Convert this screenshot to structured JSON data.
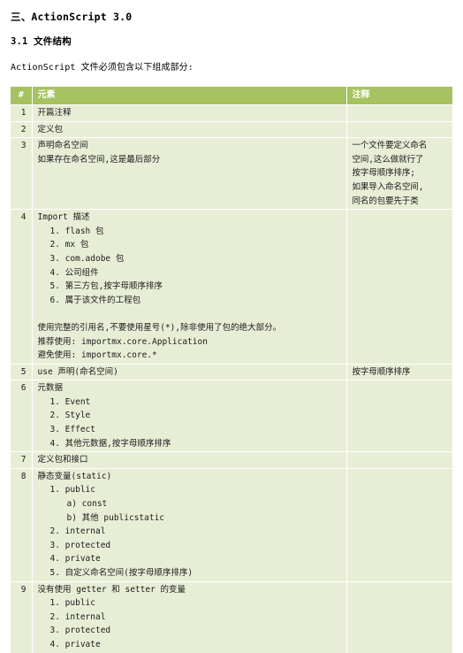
{
  "document": {
    "section_heading": "三、ActionScript 3.0",
    "sub_heading": "3.1 文件结构",
    "lead_paragraph": "ActionScript 文件必须包含以下组成部分:"
  },
  "table": {
    "headers": {
      "num": "#",
      "element": "元素",
      "note": "注释"
    },
    "rows": [
      {
        "num": "1",
        "lines": [
          "开篇注释"
        ],
        "note_lines": []
      },
      {
        "num": "2",
        "lines": [
          "定义包"
        ],
        "note_lines": []
      },
      {
        "num": "3",
        "lines": [
          "声明命名空间",
          "如果存在命名空间,这是最后部分"
        ],
        "note_lines": [
          "一个文件要定义命名",
          "空间,这么做就行了",
          "按字母顺序排序;",
          "如果导入命名空间,",
          "同名的包要先于类"
        ]
      },
      {
        "num": "4",
        "lines": [
          "Import 描述",
          "1. flash 包",
          "2. mx 包",
          "3. com.adobe 包",
          "4. 公司组件",
          "5. 第三方包,按字母顺序排序",
          "6. 属于该文件的工程包",
          "",
          "使用完整的引用名,不要使用星号(*),除非使用了包的绝大部分。",
          "推荐使用: importmx.core.Application",
          "避免使用: importmx.core.*"
        ],
        "note_lines": []
      },
      {
        "num": "5",
        "lines": [
          "use 声明(命名空间)"
        ],
        "note_lines": [
          "按字母顺序排序"
        ]
      },
      {
        "num": "6",
        "lines": [
          "元数据",
          "1. Event",
          "2. Style",
          "3. Effect",
          "4. 其他元数据,按字母顺序排序"
        ],
        "note_lines": []
      },
      {
        "num": "7",
        "lines": [
          "定义包和接口"
        ],
        "note_lines": []
      },
      {
        "num": "8",
        "lines": [
          "静态变量(static)",
          "1. public",
          "a) const",
          "b) 其他 publicstatic",
          "2. internal",
          "3. protected",
          "4. private",
          "5. 自定义命名空间(按字母顺序排序)"
        ],
        "note_lines": []
      },
      {
        "num": "9",
        "lines": [
          "没有使用 getter 和 setter 的变量",
          "1. public",
          "2. internal",
          "3. protected",
          "4. private"
        ],
        "note_lines": []
      }
    ]
  },
  "theme": {
    "header_bg": "#a6c261",
    "header_text": "#ffffff",
    "cell_bg": "#e8eed6",
    "grid_line": "#ffffff",
    "page_bg": "#ffffff",
    "text": "#000000"
  }
}
